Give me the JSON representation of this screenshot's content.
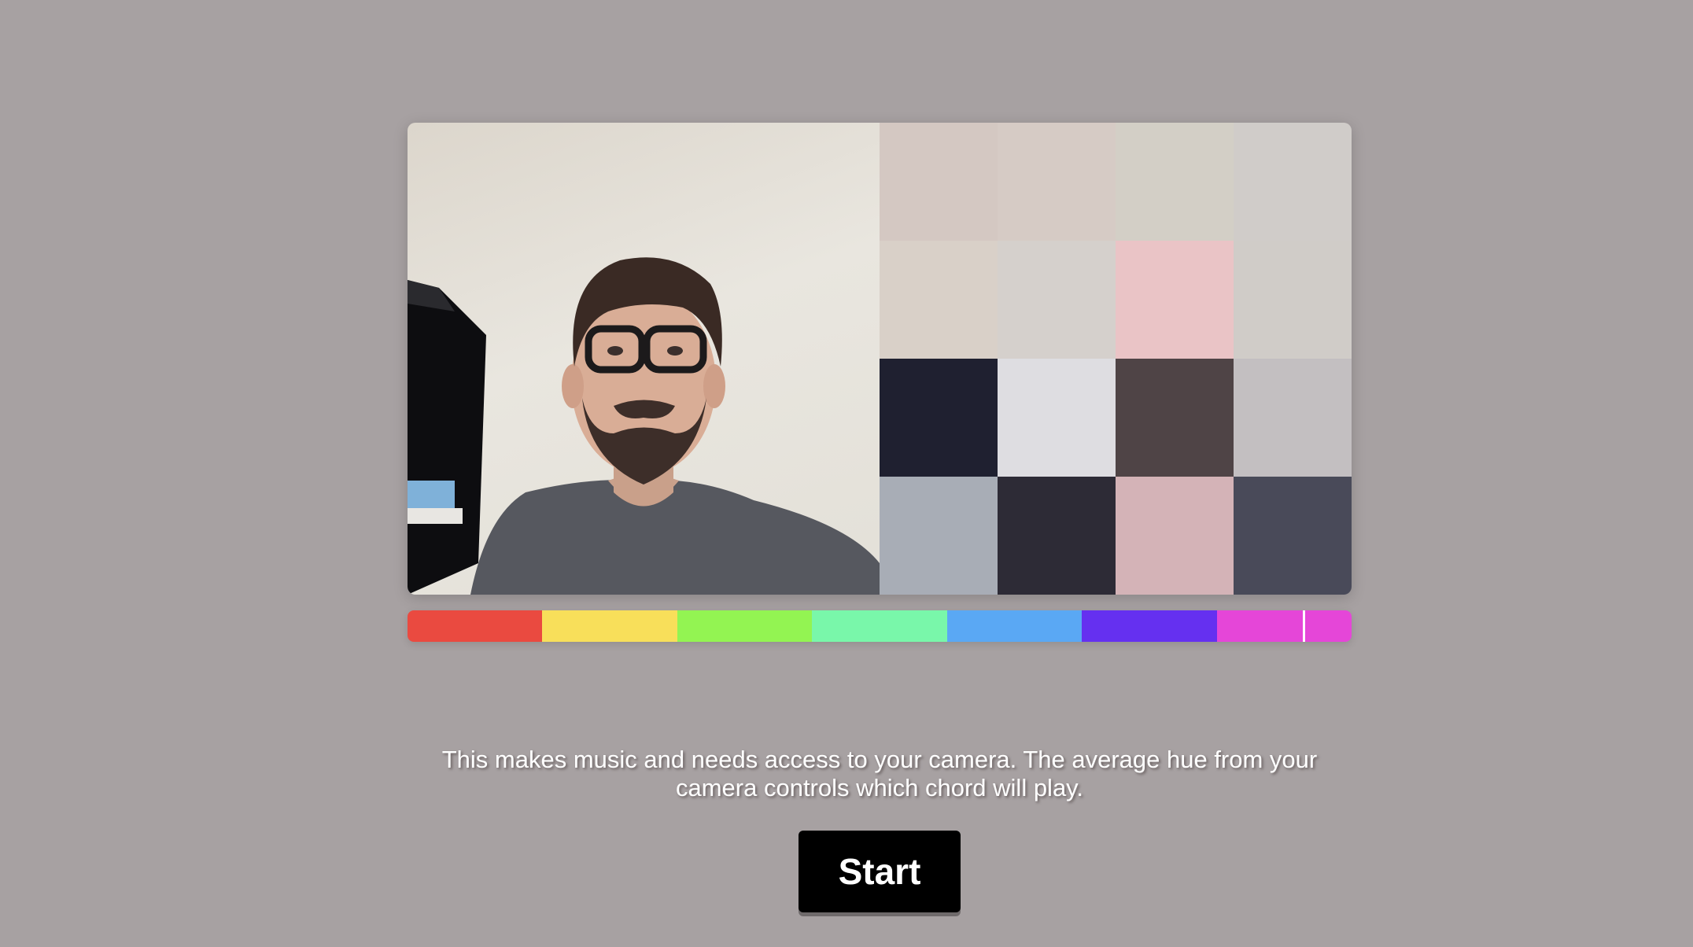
{
  "camera": {
    "subject": "webcam-feed"
  },
  "pixel_grid": {
    "colors": [
      "#d4c8c2",
      "#d6cbc5",
      "#d3cfc6",
      "#d0ccc9",
      "#d9d0c8",
      "#d5d0cc",
      "#eac4c6",
      "#d0ccc8",
      "#1f2030",
      "#dedde1",
      "#4f4446",
      "#c3bfc1",
      "#a8adb6",
      "#2d2b36",
      "#d4b3b7",
      "#494a59"
    ]
  },
  "hue_bar": {
    "segments": [
      "#ea4a40",
      "#f8df5a",
      "#93f452",
      "#79f7aa",
      "#5aa8f4",
      "#6530f0",
      "#e546d8"
    ],
    "marker_position": 0.949
  },
  "description": {
    "line1": "This makes music and needs access to your camera. The average hue from your",
    "line2": "camera controls which chord will play."
  },
  "start_button": {
    "label": "Start"
  }
}
